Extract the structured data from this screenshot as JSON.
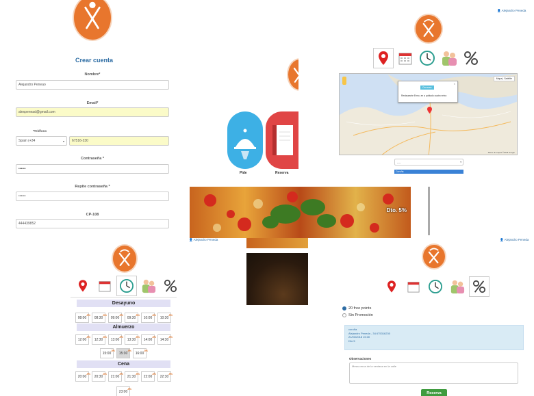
{
  "register": {
    "title": "Crear cuenta",
    "name_label": "Nombre*",
    "name_value": "Alejandro Peneao",
    "email_label": "Email*",
    "email_value": "alexpenead@gmail.com",
    "phone_label": "*Teléfono",
    "country_value": "Spain (+34",
    "phone_value": "67516-230",
    "password_label": "Contraseña *",
    "password_value": "••••••",
    "repeat_label": "Repite contraseña *",
    "repeat_value": "••••••",
    "cp_label": "CP-108",
    "cp_value": "444439852"
  },
  "user_links": {
    "top_right": "Alejandro Peneda",
    "middle": "Alejandro Peneda",
    "bottom_right": "Alejandro Peneda"
  },
  "icons": [
    "location-pin",
    "calendar",
    "clock",
    "people",
    "percent"
  ],
  "map": {
    "popup_button": "Cerrarse",
    "popup_text": "Restaurante Ermo, en a poblado cuatro entra",
    "map_type_1": "Mapa",
    "map_type_2": "Satélite",
    "dropdown_value": "----",
    "dropdown_option": "Coruña",
    "credits": "Datos de mapas ©2018 Google"
  },
  "restaurant": {
    "order_label": "Pide",
    "reserve_label": "Reserva",
    "pizza_discount": "Dto. 5%"
  },
  "schedule": {
    "sections": [
      {
        "name": "Desayuno",
        "slots": [
          "08:00",
          "08:30",
          "09:00",
          "09:30",
          "10:00",
          "10:30"
        ]
      },
      {
        "name": "Almuerzo",
        "slots": [
          "12:00",
          "12:30",
          "13:00",
          "13:30",
          "14:00",
          "14:30",
          "15:00",
          "15:30",
          "16:00"
        ]
      },
      {
        "name": "Cena",
        "slots": [
          "20:00",
          "20:30",
          "21:00",
          "21:30",
          "22:00",
          "22:30",
          "23:00"
        ]
      }
    ],
    "selected": "15:30",
    "discount": "-5%"
  },
  "booking": {
    "option_1": "20 free points",
    "option_2": "Sin Promoción",
    "info_line_1": "coruña",
    "info_line_2": "Alejandro Peneda - 34 675316230",
    "info_line_3": "21/03/2018 15:30",
    "info_line_4": "Dto 5",
    "observations_label": "Observaciones",
    "observations_placeholder": "Mesa cerca de la ventana en la calle",
    "submit": "Reserva"
  },
  "colors": {
    "brand_orange": "#e8762d",
    "link_blue": "#2e6da4",
    "schedule_header": "#e1e0f4",
    "input_yellow": "#fbfbc8",
    "button_green": "#3f9c3f"
  }
}
